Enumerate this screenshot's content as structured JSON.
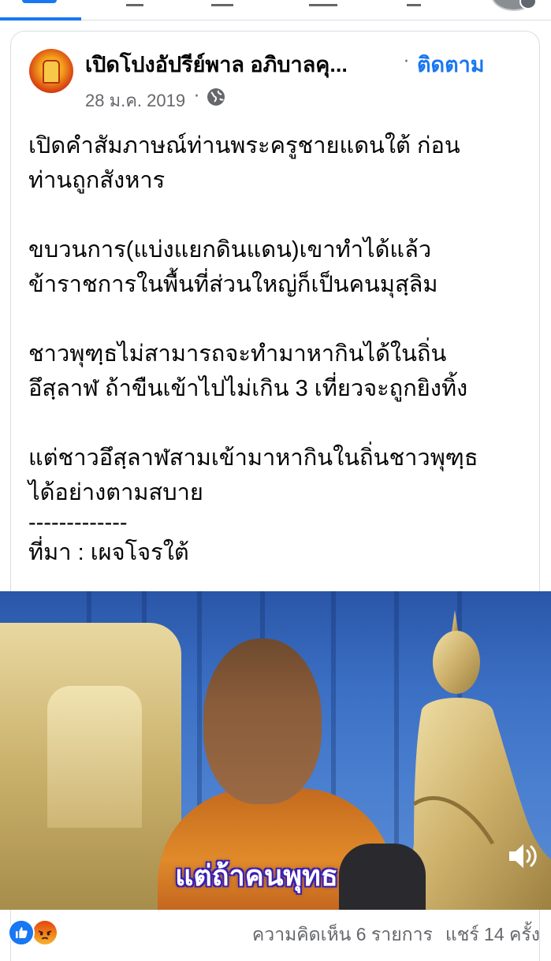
{
  "post": {
    "page_name": "เปิดโปงอัปรีย์พาล อภิบาลคุ...",
    "separator": "·",
    "follow_label": "ติดตาม",
    "date": "28 ม.ค. 2019",
    "date_separator": "·",
    "privacy_icon": "globe-icon",
    "body": {
      "p1_l1": "เปิดคำสัมภาษณ์ท่านพระครูชายแดนใต้ ก่อน",
      "p1_l2": "ท่านถูกสังหาร",
      "p2_l1": "ขบวนการ(แบ่งแยกดินแดน)เขาทำได้แล้ว",
      "p2_l2": "ข้าราชการในพื้นที่ส่วนใหญ่ก็เป็นคนมุสฺลิม",
      "p3_l1": "ชาวพุฑฺธไม่สามารถจะทำมาหากินได้ในถิ่น",
      "p3_l2": "อึสฺลาฬ ถ้าขืนเข้าไปไม่เกิน 3 เที่ยวจะถูกยิงทิ้ง",
      "p4_l1": "แต่ชาวอึสฺลาฬสามเข้ามาหากินในถิ่นชาวพุฑฺธ",
      "p4_l2": "ได้อย่างตามสบาย",
      "divider": "-------------",
      "source": "ที่มา : เผจโจรใต้"
    }
  },
  "video": {
    "subtitle": "แต่ถ้าคนพุทธ",
    "volume_icon": "volume-icon"
  },
  "footer": {
    "reactions": [
      "like",
      "angry"
    ],
    "comments": "ความคิดเห็น 6 รายการ",
    "shares": "แชร์ 14 ครั้ง"
  },
  "colors": {
    "accent": "#1877f2",
    "secondary_text": "#65676b",
    "subtitle_outline": "#3a1fb0"
  }
}
